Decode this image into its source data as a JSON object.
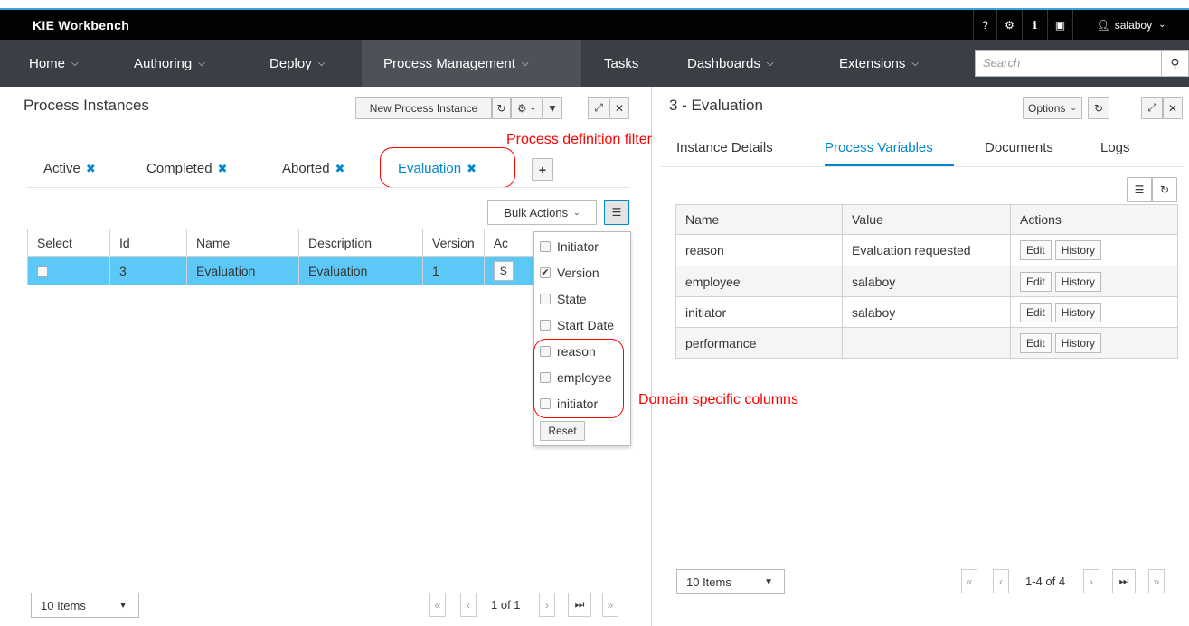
{
  "app": {
    "title": "KIE Workbench",
    "user": "salaboy"
  },
  "utility_icons": [
    "question-icon",
    "gear-icon",
    "info-icon",
    "briefcase-icon"
  ],
  "nav": {
    "items": [
      {
        "label": "Home",
        "dropdown": true
      },
      {
        "label": "Authoring",
        "dropdown": true
      },
      {
        "label": "Deploy",
        "dropdown": true
      },
      {
        "label": "Process Management",
        "dropdown": true,
        "active": true
      },
      {
        "label": "Tasks",
        "dropdown": false
      },
      {
        "label": "Dashboards",
        "dropdown": true
      },
      {
        "label": "Extensions",
        "dropdown": true
      }
    ],
    "search_placeholder": "Search"
  },
  "left": {
    "title": "Process Instances",
    "new_instance_label": "New Process Instance",
    "filter_tabs": [
      {
        "label": "Active"
      },
      {
        "label": "Completed"
      },
      {
        "label": "Aborted"
      },
      {
        "label": "Evaluation"
      }
    ],
    "bulk_actions_label": "Bulk Actions",
    "columns": [
      "Select",
      "Id",
      "Name",
      "Description",
      "Version",
      "Ac"
    ],
    "rows": [
      {
        "id": "3",
        "name": "Evaluation",
        "description": "Evaluation",
        "version": "1",
        "action": "S"
      }
    ],
    "column_menu": {
      "items": [
        {
          "label": "Initiator",
          "checked": false
        },
        {
          "label": "Version",
          "checked": true
        },
        {
          "label": "State",
          "checked": false
        },
        {
          "label": "Start Date",
          "checked": false
        },
        {
          "label": "reason",
          "checked": false
        },
        {
          "label": "employee",
          "checked": false
        },
        {
          "label": "initiator",
          "checked": false
        }
      ],
      "reset_label": "Reset"
    },
    "page_size": "10 Items",
    "page_info": "1 of 1"
  },
  "annotations": {
    "filter_note": "Process definition filter",
    "columns_note": "Domain specific columns"
  },
  "right": {
    "title": "3 - Evaluation",
    "options_label": "Options",
    "tabs": [
      {
        "label": "Instance Details",
        "active": false
      },
      {
        "label": "Process Variables",
        "active": true
      },
      {
        "label": "Documents",
        "active": false
      },
      {
        "label": "Logs",
        "active": false
      }
    ],
    "columns": [
      "Name",
      "Value",
      "Actions"
    ],
    "edit_label": "Edit",
    "history_label": "History",
    "variables": [
      {
        "name": "reason",
        "value": "Evaluation requested"
      },
      {
        "name": "employee",
        "value": "salaboy"
      },
      {
        "name": "initiator",
        "value": "salaboy"
      },
      {
        "name": "performance",
        "value": ""
      }
    ],
    "page_size": "10 Items",
    "page_info": "1-4 of 4"
  },
  "colors": {
    "accent": "#0088ce",
    "selected_row": "#5cc8f7",
    "nav_bg": "#393f44",
    "annotation": "#ff0000"
  }
}
